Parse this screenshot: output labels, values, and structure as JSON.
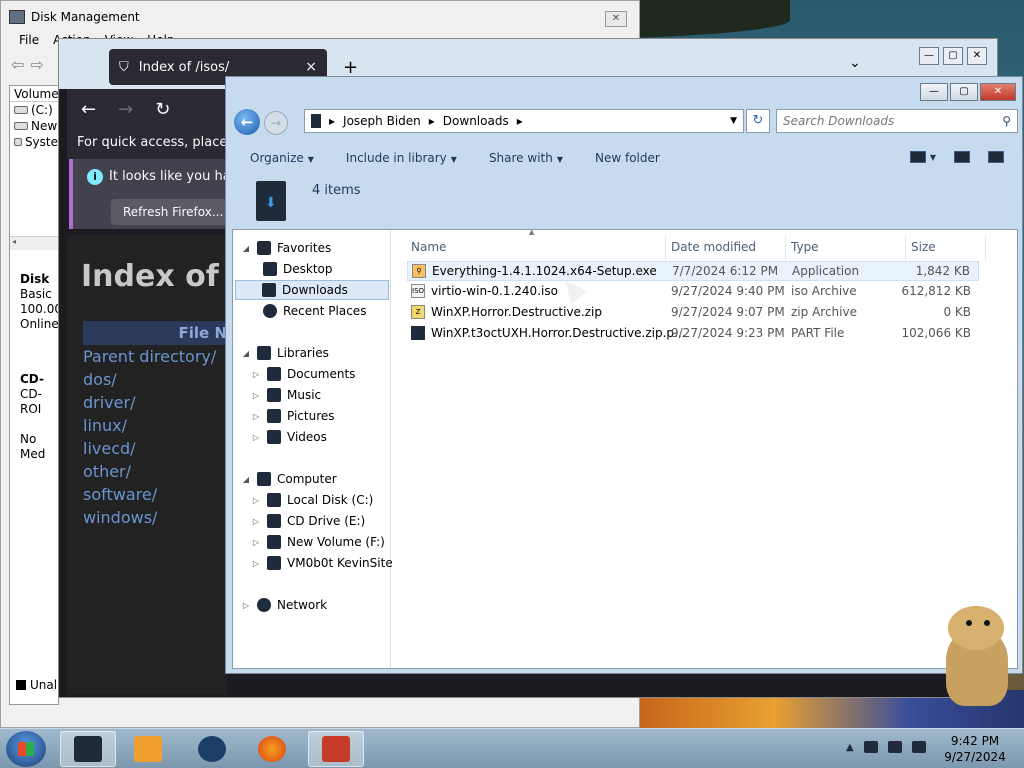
{
  "disk_management": {
    "title": "Disk Management",
    "close": "✕",
    "menu": [
      "File",
      "Action",
      "View",
      "Help"
    ],
    "volume_header": "Volume",
    "volumes": [
      "(C:)",
      "New",
      "Syste"
    ],
    "disk0": {
      "name": "Disk",
      "type": "Basic",
      "size": "100.00",
      "status": "Online"
    },
    "cd0": {
      "name": "CD-",
      "type": "CD-ROI",
      "status": "No Med"
    },
    "unallocated": "Unall"
  },
  "firefox": {
    "tab_title": "Index of /isos/",
    "tab_close": "×",
    "new_tab": "+",
    "tab_list": "⌄",
    "nav": {
      "back": "←",
      "forward": "→",
      "reload": "↻"
    },
    "quick_access": "For quick access, place your",
    "notice_text": "It looks like you haven",
    "refresh_button": "Refresh Firefox...",
    "page_heading": "Index of /",
    "file_header": "File N",
    "links": [
      "Parent directory/",
      "dos/",
      "driver/",
      "linux/",
      "livecd/",
      "other/",
      "software/",
      "windows/"
    ]
  },
  "explorer": {
    "caption": {
      "minimize": "—",
      "maximize": "▢",
      "close": "✕"
    },
    "breadcrumb": [
      "Joseph Biden",
      "Downloads"
    ],
    "search_placeholder": "Search Downloads",
    "toolbar": {
      "organize": "Organize",
      "include": "Include in library",
      "share": "Share with",
      "new_folder": "New folder"
    },
    "item_count": "4 items",
    "nav": {
      "favorites": "Favorites",
      "desktop": "Desktop",
      "downloads": "Downloads",
      "recent": "Recent Places",
      "libraries": "Libraries",
      "documents": "Documents",
      "music": "Music",
      "pictures": "Pictures",
      "videos": "Videos",
      "computer": "Computer",
      "local_disk": "Local Disk (C:)",
      "cd_drive": "CD Drive (E:)",
      "new_volume": "New Volume (F:)",
      "vm": "VM0b0t KevinSite",
      "network": "Network"
    },
    "columns": {
      "name": "Name",
      "date": "Date modified",
      "type": "Type",
      "size": "Size"
    },
    "files": [
      {
        "name": "Everything-1.4.1.1024.x64-Setup.exe",
        "date": "7/7/2024 6:12 PM",
        "type": "Application",
        "size": "1,842 KB",
        "icon": "app-icon"
      },
      {
        "name": "virtio-win-0.1.240.iso",
        "date": "9/27/2024 9:40 PM",
        "type": "iso Archive",
        "size": "612,812 KB",
        "icon": "iso-icon"
      },
      {
        "name": "WinXP.Horror.Destructive.zip",
        "date": "9/27/2024 9:07 PM",
        "type": "zip Archive",
        "size": "0 KB",
        "icon": "zip-icon"
      },
      {
        "name": "WinXP.t3octUXH.Horror.Destructive.zip.p...",
        "date": "9/27/2024 9:23 PM",
        "type": "PART File",
        "size": "102,066 KB",
        "icon": "part-icon"
      }
    ]
  },
  "taskbar": {
    "time": "9:42 PM",
    "date": "9/27/2024",
    "tray_arrow": "▲"
  }
}
